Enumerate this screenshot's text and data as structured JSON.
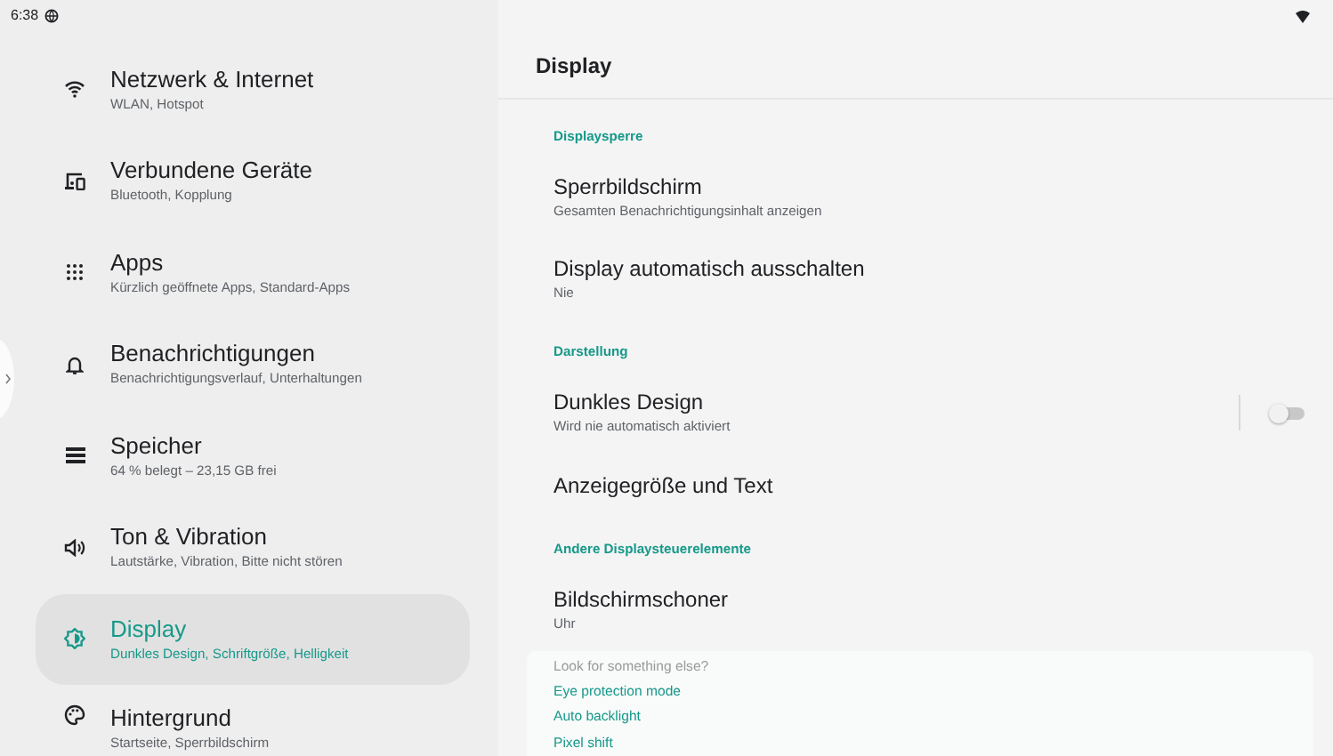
{
  "status_bar": {
    "time": "6:38"
  },
  "sidebar": {
    "items": [
      {
        "title": "Netzwerk & Internet",
        "summary": "WLAN, Hotspot",
        "selected": false
      },
      {
        "title": "Verbundene Geräte",
        "summary": "Bluetooth, Kopplung",
        "selected": false
      },
      {
        "title": "Apps",
        "summary": "Kürzlich geöffnete Apps, Standard-Apps",
        "selected": false
      },
      {
        "title": "Benachrichtigungen",
        "summary": "Benachrichtigungsverlauf, Unterhaltungen",
        "selected": false
      },
      {
        "title": "Speicher",
        "summary": "64 % belegt – 23,15 GB frei",
        "selected": false
      },
      {
        "title": "Ton & Vibration",
        "summary": "Lautstärke, Vibration, Bitte nicht stören",
        "selected": false
      },
      {
        "title": "Display",
        "summary": "Dunkles Design, Schriftgröße, Helligkeit",
        "selected": true
      },
      {
        "title": "Hintergrund",
        "summary": "Startseite, Sperrbildschirm",
        "selected": false
      }
    ]
  },
  "page": {
    "title": "Display",
    "sections": [
      {
        "header": "Displaysperre",
        "rows": [
          {
            "kind": "plain",
            "title": "Sperrbildschirm",
            "summary": "Gesamten Benachrichtigungsinhalt anzeigen"
          },
          {
            "kind": "plain",
            "title": "Display automatisch ausschalten",
            "summary": "Nie"
          }
        ]
      },
      {
        "header": "Darstellung",
        "rows": [
          {
            "kind": "switch",
            "title": "Dunkles Design",
            "summary": "Wird nie automatisch aktiviert",
            "on": false
          },
          {
            "kind": "plain",
            "title": "Anzeigegröße und Text"
          }
        ]
      },
      {
        "header": "Andere Displaysteuerelemente",
        "rows": [
          {
            "kind": "plain",
            "title": "Bildschirmschoner",
            "summary": "Uhr"
          }
        ]
      }
    ]
  },
  "suggestions": {
    "prompt": "Look for something else?",
    "links": [
      "Eye protection mode",
      "Auto backlight",
      "Pixel shift"
    ]
  }
}
